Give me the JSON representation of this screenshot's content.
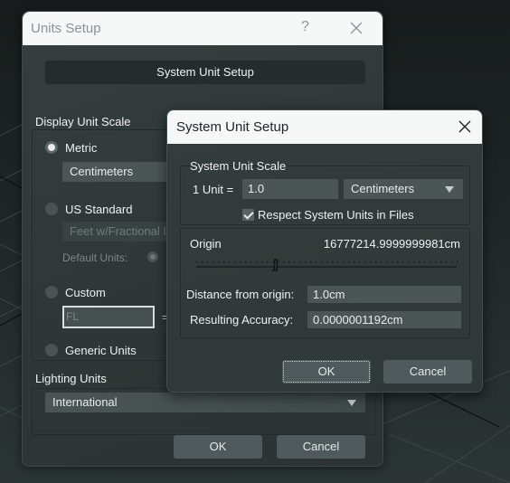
{
  "units_dialog": {
    "title": "Units Setup",
    "help_label": "?",
    "close_icon": "close-icon",
    "system_unit_setup_button": "System Unit Setup",
    "display_unit_scale": {
      "label": "Display Unit Scale",
      "selected": "Metric",
      "options": [
        {
          "label": "Metric",
          "checked": true
        },
        {
          "label": "US Standard",
          "checked": false
        },
        {
          "label": "Custom",
          "checked": false
        },
        {
          "label": "Generic Units",
          "checked": false
        }
      ],
      "metric_dropdown_value": "Centimeters",
      "us_standard_dropdown_value": "Feet w/Fractional I",
      "default_units_label": "Default Units:",
      "custom_field_value": "FL",
      "custom_equals": "="
    },
    "lighting_units": {
      "label": "Lighting Units",
      "dropdown_value": "International"
    },
    "ok_label": "OK",
    "cancel_label": "Cancel"
  },
  "system_dialog": {
    "title": "System Unit Setup",
    "close_icon": "close-icon",
    "system_unit_scale": {
      "label": "System Unit Scale",
      "unit_label": "1 Unit =",
      "unit_value": "1.0",
      "unit_type": "Centimeters",
      "respect_label": "Respect System Units in Files",
      "respect_checked": true
    },
    "origin": {
      "label": "Origin",
      "value": "16777214.9999999981cm",
      "slider_position": 0.3
    },
    "distance_label": "Distance from origin:",
    "distance_value": "1.0cm",
    "accuracy_label": "Resulting Accuracy:",
    "accuracy_value": "0.0000001192cm",
    "ok_label": "OK",
    "cancel_label": "Cancel"
  }
}
